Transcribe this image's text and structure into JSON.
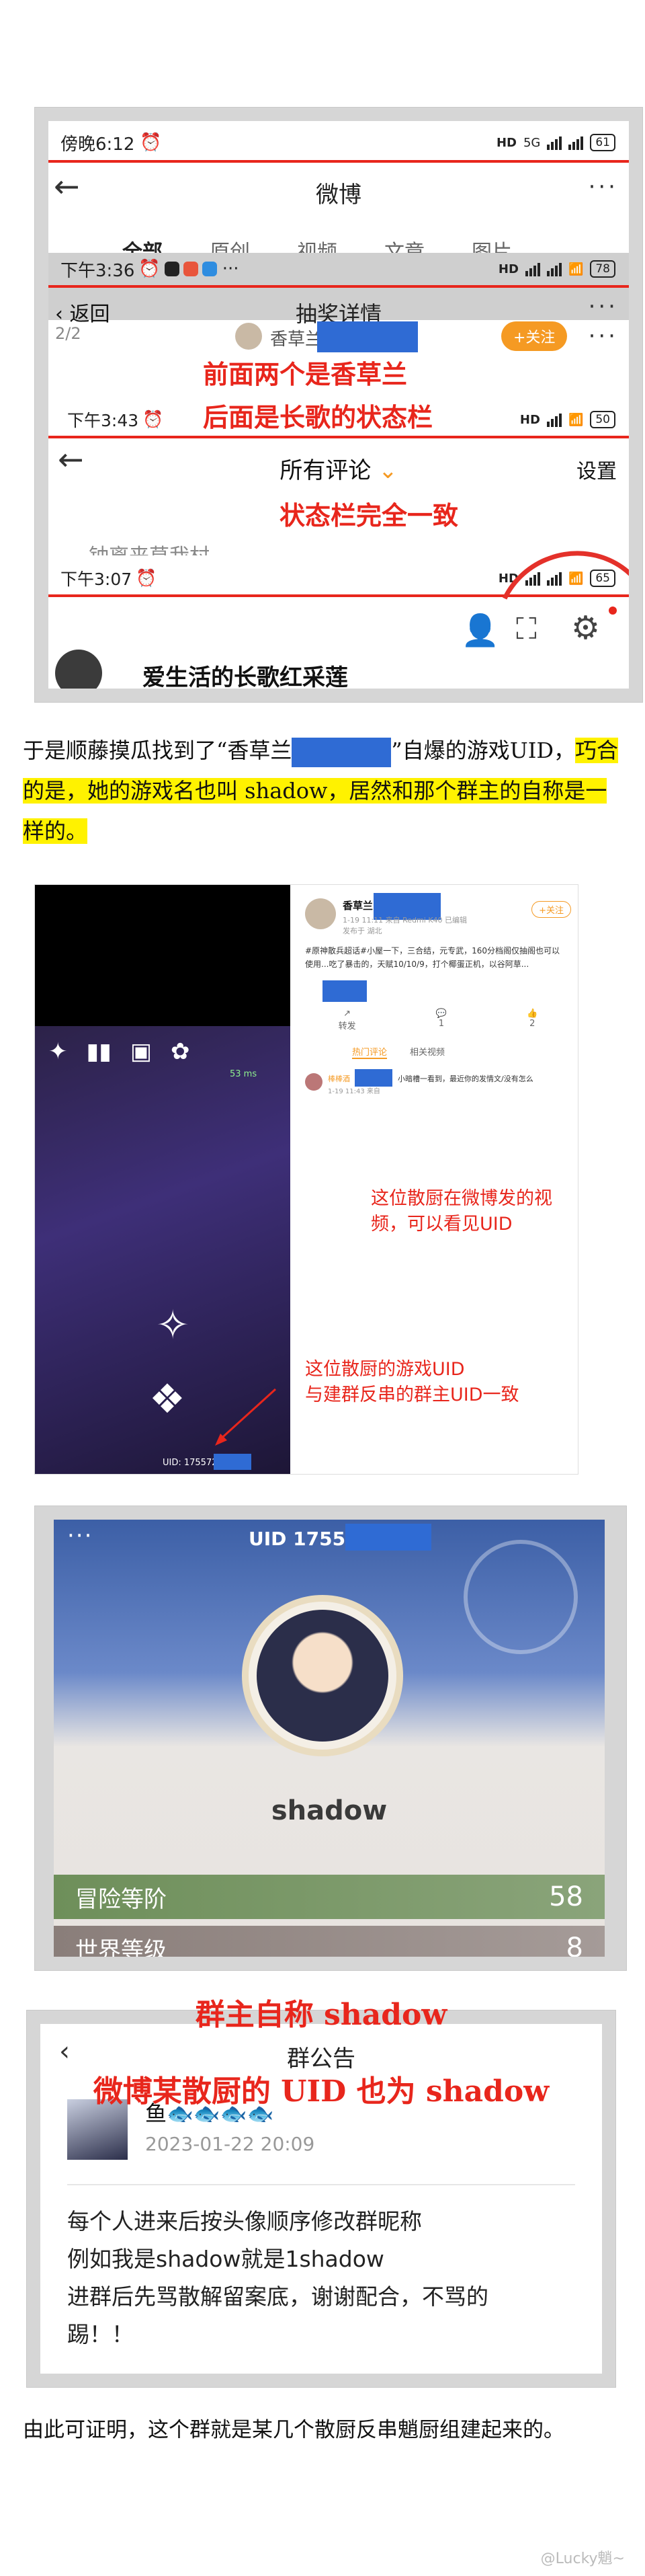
{
  "panel1": {
    "bar1": {
      "time": "傍晚6:12",
      "network": "5G",
      "battery": "61"
    },
    "weibo_title": "微博",
    "weibo_tabs": [
      "全部",
      "原创",
      "视频",
      "文章",
      "图片"
    ],
    "bar2": {
      "time": "下午3:36",
      "battery": "78"
    },
    "back_label": "返回",
    "lottery_title": "抽奖详情",
    "page_indicator": "2/2",
    "user_name": "香草兰",
    "follow_label": "+关注",
    "caption_line1": "前面两个是香草兰",
    "caption_line2": "后面是长歌的状态栏",
    "bar3": {
      "time": "下午3:43",
      "battery": "50"
    },
    "comments_title": "所有评论",
    "settings_label": "设置",
    "caption3": "状态栏完全一致",
    "snippet_text": "钟离来草我村",
    "bar4": {
      "time": "下午3:07",
      "battery": "65"
    },
    "bottom_user": "爱生活的长歌红采莲"
  },
  "paragraph1": {
    "part1": "于是顺藤摸瓜找到了“香草兰",
    "part2": "”自爆的游戏UID，",
    "part3_highlight": "巧合的是，她的游戏名也叫 shadow，居然和那个群主的自称是一样的。"
  },
  "panel2": {
    "poster": "香草兰",
    "post_time": "1-19 11:11 来自 Redmi K40 已编辑",
    "post_src": "发布于 湖北",
    "follow": "+关注",
    "post_text": "#原神散兵超话#小屋一下，三合结，元专武，160分档阁仅抽阁也可以使用...吃了暴击的，天赋10/10/9，打个椰蛋正机，以谷阿草...",
    "share": "转发",
    "comment_count": "1",
    "like_count": "2",
    "tab_hot": "热门评论",
    "tab_related": "相关视频",
    "commenter": "棒棒酒",
    "comment": "小暗槽一看到，最近你的发情文/没有怎么",
    "comment_time": "1-19 11:43 来自",
    "fps": "53 ms",
    "uid_prefix": "UID: 175572",
    "note1": "这位散厨在微博发的视频，可以看见UID",
    "note2_line1": "这位散厨的游戏UID",
    "note2_line2": "与建群反串的群主UID一致"
  },
  "panel3": {
    "uid_prefix": "UID 1755",
    "name": "shadow",
    "adventure_label": "冒险等阶",
    "adventure_value": "58",
    "world_label": "世界等级",
    "world_value": "8"
  },
  "panel4": {
    "caption1": "群主自称 shadow",
    "caption2": "微博某散厨的 UID 也为 shadow",
    "title": "群公告",
    "author": "鱼🐟🐟🐟🐟",
    "timestamp": "2023-01-22 20:09",
    "line1": "每个人进来后按头像顺序修改群昵称",
    "line2": "例如我是shadow就是1shadow",
    "line3": "进群后先骂散解留案底，谢谢配合，不骂的",
    "line4": "踢！！"
  },
  "footer": {
    "text": "由此可证明，这个群就是某几个散厨反串魈厨组建起来的。",
    "watermark": "@Lucky魈~"
  }
}
